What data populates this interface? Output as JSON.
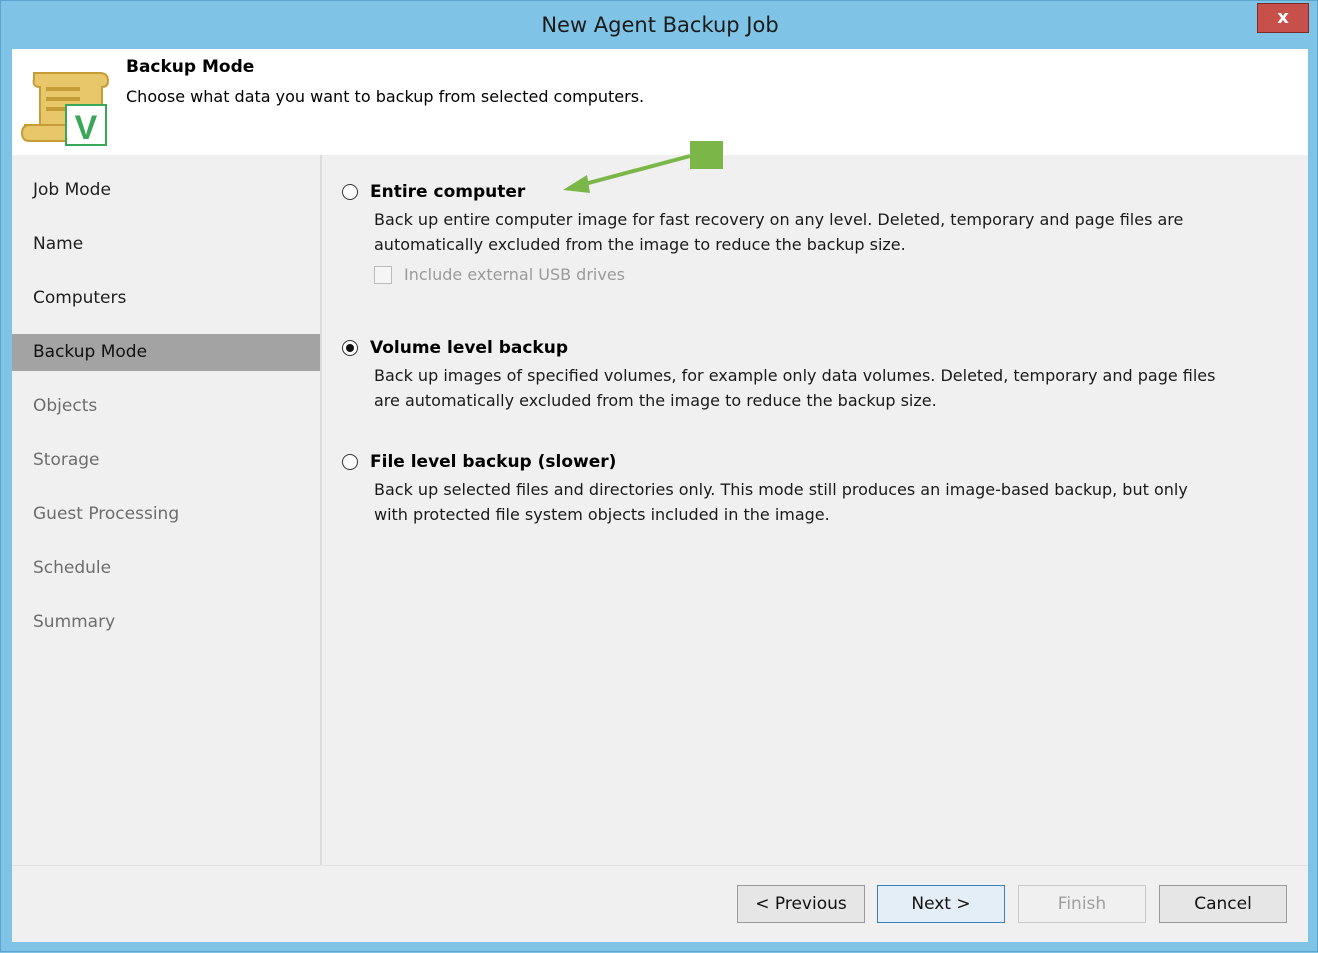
{
  "window": {
    "title": "New Agent Backup Job",
    "close_label": "x"
  },
  "header": {
    "title": "Backup Mode",
    "description": "Choose what data you want to backup from selected computers.",
    "icon": "scroll-with-v-icon"
  },
  "sidebar": {
    "items": [
      {
        "label": "Job Mode",
        "state": "normal"
      },
      {
        "label": "Name",
        "state": "normal"
      },
      {
        "label": "Computers",
        "state": "normal"
      },
      {
        "label": "Backup Mode",
        "state": "active"
      },
      {
        "label": "Objects",
        "state": "disabled"
      },
      {
        "label": "Storage",
        "state": "disabled"
      },
      {
        "label": "Guest Processing",
        "state": "disabled"
      },
      {
        "label": "Schedule",
        "state": "disabled"
      },
      {
        "label": "Summary",
        "state": "disabled"
      }
    ]
  },
  "options": [
    {
      "label": "Entire computer",
      "checked": false,
      "desc_line1": "Back up entire computer image for fast recovery on any level. Deleted, temporary and page files are",
      "desc_line2": "automatically excluded from the image to reduce the backup size."
    },
    {
      "label": "Volume level backup",
      "checked": true,
      "desc_line1": "Back up images of specified volumes, for example only data volumes. Deleted, temporary and page files",
      "desc_line2": "are automatically excluded from the image to reduce the backup size."
    },
    {
      "label": "File level backup (slower)",
      "checked": false,
      "desc_line1": "Back up selected files and directories only. This mode still produces an image-based backup, but only",
      "desc_line2": "with protected file system objects included in the image."
    }
  ],
  "usb_checkbox": {
    "label": "Include external USB drives",
    "checked": false,
    "enabled": false
  },
  "buttons": {
    "previous": "< Previous",
    "next": "Next >",
    "finish": "Finish",
    "cancel": "Cancel"
  },
  "colors": {
    "titlebar": "#7fc4e6",
    "close": "#c7504b",
    "active_item": "#a3a3a3",
    "annotation_green": "#7ab648"
  }
}
